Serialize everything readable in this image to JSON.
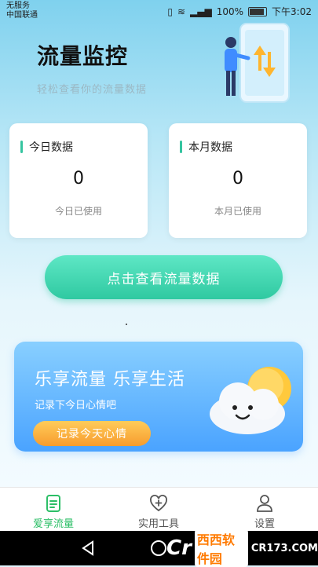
{
  "status_bar": {
    "carrier_line1": "无服务",
    "carrier_line2": "中国联通",
    "battery": "100%",
    "time": "下午3:02"
  },
  "header": {
    "title": "流量监控",
    "subtitle": "轻松查看你的流量数据"
  },
  "cards": [
    {
      "label": "今日数据",
      "value": "0",
      "caption": "今日已使用"
    },
    {
      "label": "本月数据",
      "value": "0",
      "caption": "本月已使用"
    }
  ],
  "cta": {
    "label": "点击查看流量数据"
  },
  "banner": {
    "title": "乐享流量 乐享生活",
    "subtitle": "记录下今日心情吧",
    "button": "记录今天心情"
  },
  "tabs": [
    {
      "label": "爱享流量",
      "icon": "document-icon",
      "active": true
    },
    {
      "label": "实用工具",
      "icon": "heart-plus-icon",
      "active": false
    },
    {
      "label": "设置",
      "icon": "person-icon",
      "active": false
    }
  ],
  "watermark": {
    "brand": "西西软件园",
    "site": "CR173.COM"
  },
  "colors": {
    "accent": "#2fc9a1",
    "tab_active": "#2cbf67",
    "banner": "#4aa3ff",
    "button_orange": "#f79c2e"
  }
}
